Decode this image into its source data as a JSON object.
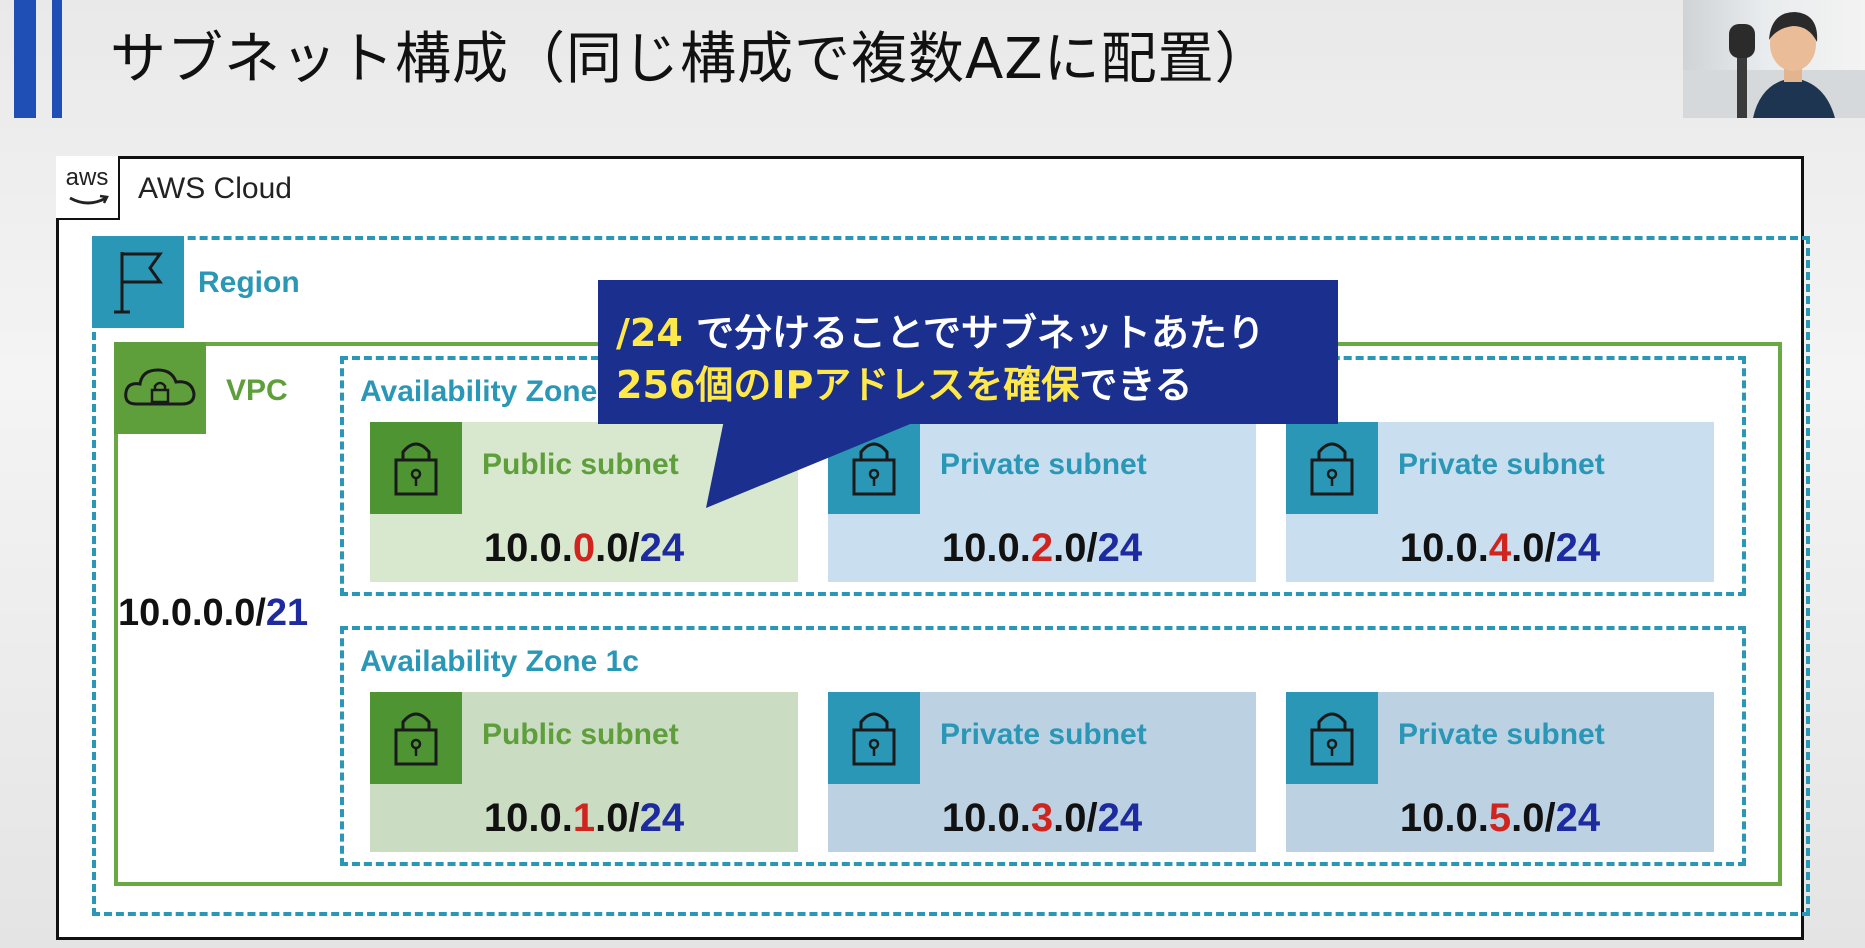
{
  "slide": {
    "title": "サブネット構成（同じ構成で複数AZに配置）"
  },
  "diagram": {
    "cloud_label": "AWS Cloud",
    "aws_logo_text": "aws",
    "region_label": "Region",
    "vpc_label": "VPC",
    "vpc_cidr": {
      "base": "10.0.0.0/",
      "prefix": "21"
    },
    "zones": [
      {
        "label": "Availability Zone",
        "subnets": [
          {
            "label": "Public subnet",
            "cidr_pre": "10.0.",
            "octet": "0",
            "cidr_mid": ".0/",
            "prefix": "24"
          },
          {
            "label": "Private subnet",
            "cidr_pre": "10.0.",
            "octet": "2",
            "cidr_mid": ".0/",
            "prefix": "24"
          },
          {
            "label": "Private subnet",
            "cidr_pre": "10.0.",
            "octet": "4",
            "cidr_mid": ".0/",
            "prefix": "24"
          }
        ]
      },
      {
        "label": "Availability Zone 1c",
        "subnets": [
          {
            "label": "Public subnet",
            "cidr_pre": "10.0.",
            "octet": "1",
            "cidr_mid": ".0/",
            "prefix": "24"
          },
          {
            "label": "Private subnet",
            "cidr_pre": "10.0.",
            "octet": "3",
            "cidr_mid": ".0/",
            "prefix": "24"
          },
          {
            "label": "Private subnet",
            "cidr_pre": "10.0.",
            "octet": "5",
            "cidr_mid": ".0/",
            "prefix": "24"
          }
        ]
      }
    ]
  },
  "callout": {
    "line1_highlight": "/24",
    "line1_rest": " で分けることでサブネットあたり",
    "line2_highlight": "256個のIPアドレスを確保",
    "line2_rest": "できる"
  },
  "colors": {
    "title_bar": "#1f4fb4",
    "aws_teal": "#2a97b6",
    "vpc_green": "#5e9f3c",
    "callout_bg": "#1a2f8e",
    "callout_highlight": "#ffe94a",
    "octet_red": "#d0241e",
    "prefix_blue": "#1d2aa0"
  }
}
